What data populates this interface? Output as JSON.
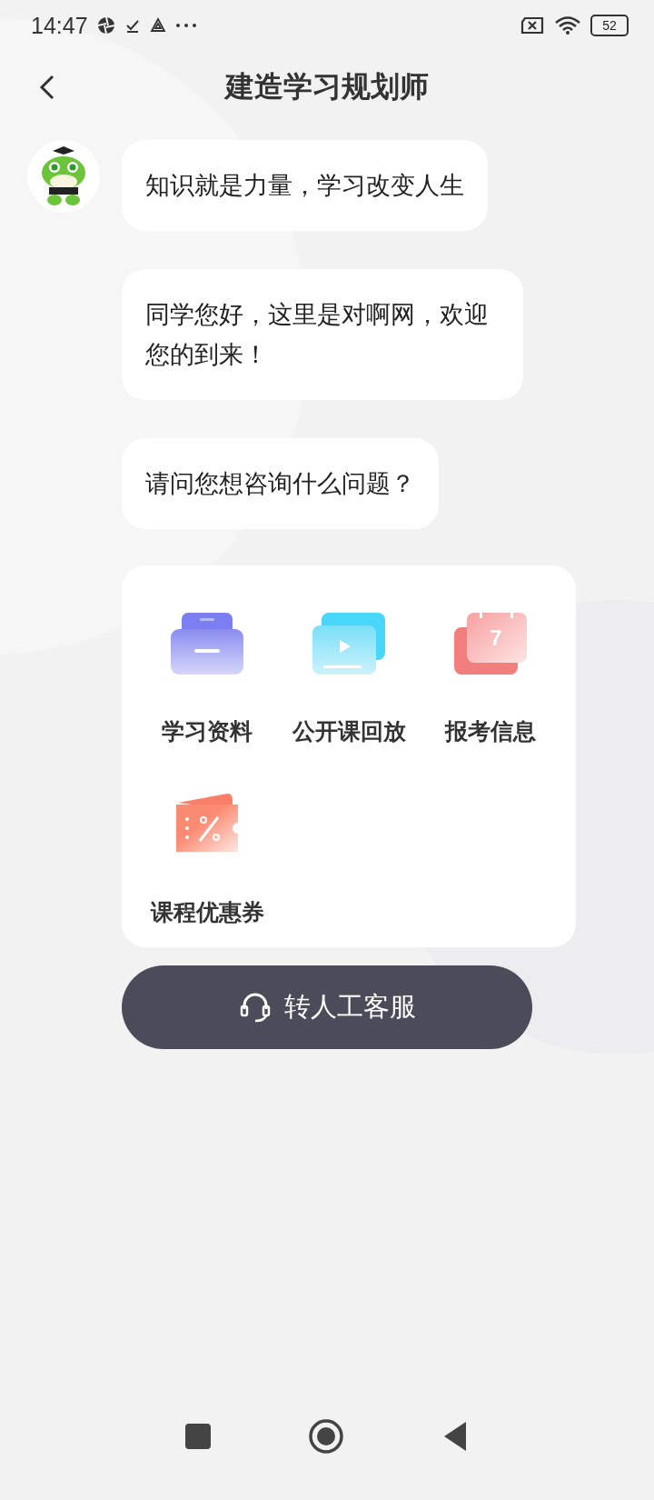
{
  "status_bar": {
    "time": "14:47",
    "battery": "52"
  },
  "header": {
    "title": "建造学习规划师"
  },
  "messages": [
    "知识就是力量，学习改变人生",
    "同学您好，这里是对啊网，欢迎您的到来！",
    "请问您想咨询什么问题？"
  ],
  "menu": [
    {
      "kind": "folder",
      "label": "学习资料"
    },
    {
      "kind": "video",
      "label": "公开课回放"
    },
    {
      "kind": "calendar",
      "label": "报考信息",
      "icon_text": "7"
    },
    {
      "kind": "coupon",
      "label": "课程优惠券"
    }
  ],
  "service_button": {
    "label": "转人工客服"
  }
}
